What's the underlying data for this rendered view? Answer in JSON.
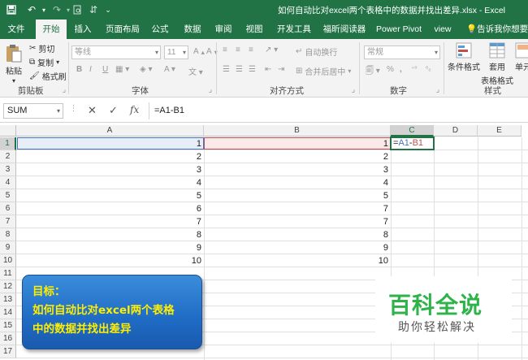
{
  "titlebar": {
    "save_icon": "save-icon",
    "undo_icon": "undo-icon",
    "redo_icon": "redo-icon",
    "title": "如何自动比对excel两个表格中的数据并找出差异.xlsx  -  Excel"
  },
  "tabs": [
    {
      "label": "文件"
    },
    {
      "label": "开始"
    },
    {
      "label": "插入"
    },
    {
      "label": "页面布局"
    },
    {
      "label": "公式"
    },
    {
      "label": "数据"
    },
    {
      "label": "审阅"
    },
    {
      "label": "视图"
    },
    {
      "label": "开发工具"
    },
    {
      "label": "福昕阅读器"
    },
    {
      "label": "Power Pivot"
    },
    {
      "label": "view"
    },
    {
      "label": "告诉我你想要做"
    }
  ],
  "ribbon": {
    "clipboard": {
      "paste": "粘贴",
      "cut": "剪切",
      "copy": "复制",
      "format_painter": "格式刷",
      "group": "剪贴板"
    },
    "font": {
      "font_name": "等线",
      "font_size": "11",
      "group": "字体",
      "bold": "B",
      "italic": "I",
      "underline": "U"
    },
    "alignment": {
      "wrap": "自动换行",
      "merge": "合并后居中",
      "group": "对齐方式"
    },
    "number": {
      "format": "常规",
      "percent": "%",
      "comma": ",",
      "group": "数字"
    },
    "styles": {
      "conditional": "条件格式",
      "table1": "套用",
      "table2": "表格格式",
      "cell": "单元",
      "group": "样式"
    }
  },
  "formula_bar": {
    "name_box": "SUM",
    "cancel": "✕",
    "enter": "✓",
    "fx": "fx",
    "formula": "=A1-B1"
  },
  "sheet": {
    "columns": [
      "A",
      "B",
      "C",
      "D",
      "E"
    ],
    "rows": [
      "1",
      "2",
      "3",
      "4",
      "5",
      "6",
      "7",
      "8",
      "9",
      "10",
      "11",
      "12",
      "13",
      "14",
      "15",
      "16",
      "17"
    ],
    "col_a": [
      "1",
      "2",
      "3",
      "4",
      "5",
      "6",
      "7",
      "8",
      "9",
      "10"
    ],
    "col_b": [
      "1",
      "2",
      "3",
      "4",
      "5",
      "7",
      "7",
      "8",
      "9",
      "10"
    ],
    "editing_cell": {
      "ref": "C1",
      "formula": "=A1-B1"
    }
  },
  "banner": {
    "line1": "目标：",
    "line2": "如何自动比对excel两个表格",
    "line3": "中的数据并找出差异"
  },
  "watermark": {
    "title": "百科全说",
    "subtitle": "助你轻松解决"
  },
  "colors": {
    "excel_green": "#217346",
    "ref_a": "#4472c4",
    "ref_b": "#c0504d",
    "banner_text": "#ffee00"
  }
}
